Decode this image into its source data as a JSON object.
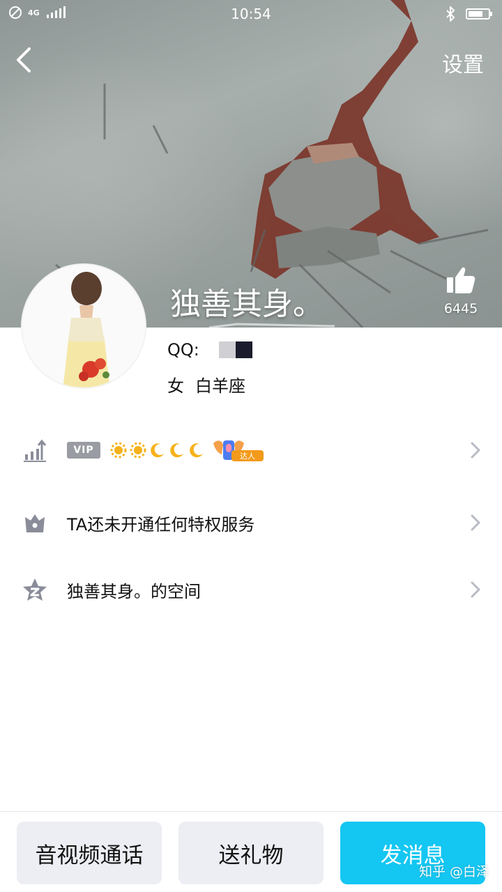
{
  "status_bar": {
    "time": "10:54",
    "network": "4G",
    "icons": [
      "dnd-icon",
      "signal-icon",
      "bluetooth-icon",
      "battery-icon"
    ]
  },
  "header": {
    "back_icon": "chevron-left-icon",
    "settings_label": "设置"
  },
  "profile": {
    "nickname": "独善其身。",
    "like_count": "6445",
    "qq_label": "QQ:",
    "gender": "女",
    "zodiac": "白羊座"
  },
  "rows": {
    "level": {
      "icon": "level-chart-icon",
      "vip_badge": "VIP",
      "level_icons": [
        "sun",
        "sun",
        "moon",
        "moon",
        "moon"
      ],
      "daren_badge": "达人"
    },
    "privilege": {
      "icon": "crown-icon",
      "label": "TA还未开通任何特权服务"
    },
    "space": {
      "icon": "qzone-star-icon",
      "label": "独善其身。的空间"
    }
  },
  "bottom_bar": {
    "av_call": "音视频通话",
    "send_gift": "送礼物",
    "send_message": "发消息"
  },
  "watermark": "知乎 @白泽",
  "colors": {
    "accent": "#14c6f2",
    "button_bg": "#eceef3",
    "icon_gray": "#8a8d99"
  }
}
